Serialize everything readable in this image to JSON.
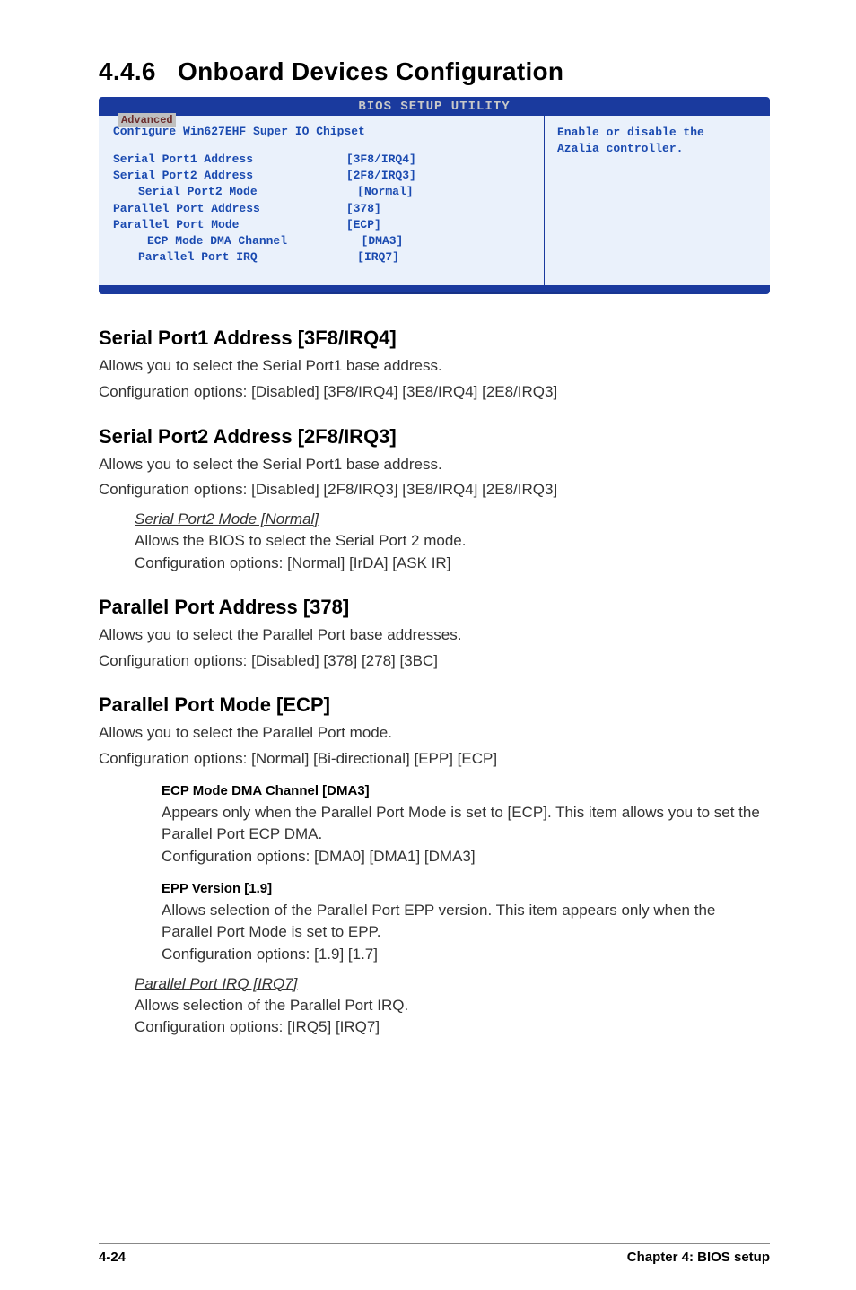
{
  "section": {
    "number": "4.4.6",
    "title": "Onboard Devices Configuration"
  },
  "bios": {
    "title": "BIOS SETUP UTILITY",
    "tab": "Advanced",
    "header": "Configure Win627EHF Super IO Chipset",
    "rows": [
      {
        "label": "Serial Port1 Address",
        "value": "[3F8/IRQ4]",
        "indent": 0
      },
      {
        "label": "Serial Port2 Address",
        "value": "[2F8/IRQ3]",
        "indent": 0
      },
      {
        "label": "Serial Port2 Mode",
        "value": "[Normal]",
        "indent": 1
      },
      {
        "label": "Parallel Port Address",
        "value": "[378]",
        "indent": 0
      },
      {
        "label": "Parallel Port Mode",
        "value": "[ECP]",
        "indent": 0
      },
      {
        "label": "ECP Mode DMA Channel",
        "value": "[DMA3]",
        "indent": 2
      },
      {
        "label": "Parallel Port IRQ",
        "value": "[IRQ7]",
        "indent": 1
      }
    ],
    "right1": "Enable or disable the",
    "right2": "Azalia controller."
  },
  "serial1": {
    "heading": "Serial Port1 Address [3F8/IRQ4]",
    "line1": "Allows you to select the Serial Port1 base address.",
    "line2": "Configuration options: [Disabled] [3F8/IRQ4] [3E8/IRQ4] [2E8/IRQ3]"
  },
  "serial2": {
    "heading": "Serial Port2 Address [2F8/IRQ3]",
    "line1": "Allows you to select the Serial Port1 base address.",
    "line2": "Configuration options: [Disabled] [2F8/IRQ3] [3E8/IRQ4] [2E8/IRQ3]",
    "sub_head": "Serial Port2 Mode [Normal]",
    "sub_line1": "Allows the BIOS to select the Serial Port 2 mode.",
    "sub_line2": "Configuration options: [Normal] [IrDA] [ASK IR]"
  },
  "parallel_addr": {
    "heading": "Parallel Port Address [378]",
    "line1": "Allows you to select the Parallel Port base addresses.",
    "line2": "Configuration options: [Disabled] [378] [278] [3BC]"
  },
  "parallel_mode": {
    "heading": "Parallel Port Mode [ECP]",
    "line1": "Allows you to select the Parallel Port  mode.",
    "line2": "Configuration options: [Normal] [Bi-directional] [EPP] [ECP]",
    "ecp_head": "ECP Mode DMA Channel [DMA3]",
    "ecp_line1": "Appears only when the Parallel Port Mode is set to [ECP]. This item allows you to set the Parallel Port ECP DMA.",
    "ecp_line2": "Configuration options: [DMA0] [DMA1] [DMA3]",
    "epp_head": "EPP Version [1.9]",
    "epp_line1": "Allows selection of the Parallel Port EPP version. This item appears only when the Parallel Port Mode is set to EPP.",
    "epp_line2": "Configuration options: [1.9] [1.7]",
    "irq_head": "Parallel Port IRQ [IRQ7]",
    "irq_line1": "Allows selection of the Parallel Port IRQ.",
    "irq_line2": "Configuration options: [IRQ5] [IRQ7]"
  },
  "footer": {
    "left": "4-24",
    "right": "Chapter 4: BIOS setup"
  }
}
